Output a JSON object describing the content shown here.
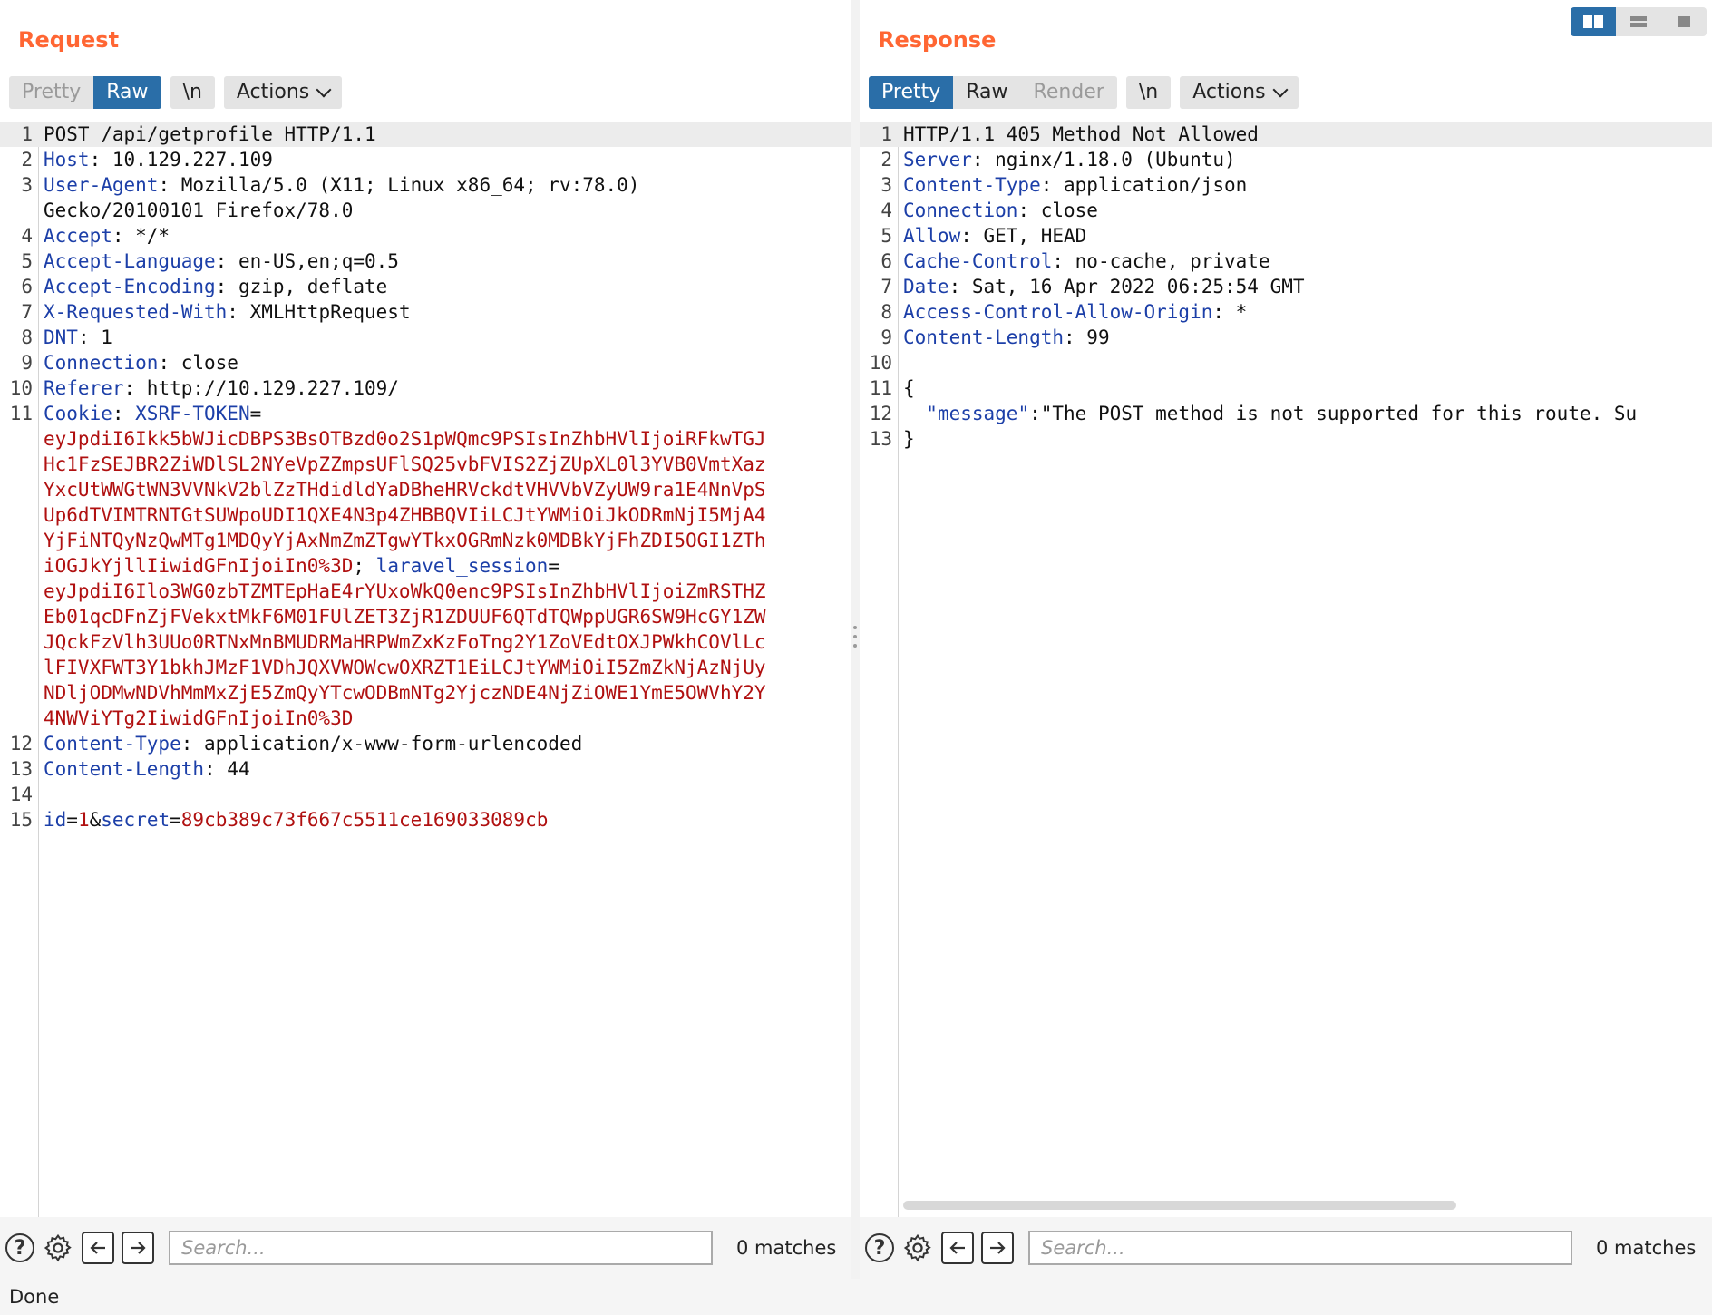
{
  "request": {
    "title": "Request",
    "tabs": [
      "Pretty",
      "Raw"
    ],
    "newline_label": "\\n",
    "actions_label": "Actions",
    "lines": [
      {
        "n": "1",
        "parts": [
          {
            "t": "POST /api/getprofile HTTP/1.1",
            "c": "v"
          }
        ]
      },
      {
        "n": "2",
        "parts": [
          {
            "t": "Host",
            "c": "k"
          },
          {
            "t": ": 10.129.227.109",
            "c": "v"
          }
        ]
      },
      {
        "n": "3",
        "parts": [
          {
            "t": "User-Agent",
            "c": "k"
          },
          {
            "t": ": Mozilla/5.0 (X11; Linux x86_64; rv:78.0)",
            "c": "v"
          }
        ]
      },
      {
        "n": "",
        "parts": [
          {
            "t": "Gecko/20100101 Firefox/78.0",
            "c": "v"
          }
        ]
      },
      {
        "n": "4",
        "parts": [
          {
            "t": "Accept",
            "c": "k"
          },
          {
            "t": ": */*",
            "c": "v"
          }
        ]
      },
      {
        "n": "5",
        "parts": [
          {
            "t": "Accept-Language",
            "c": "k"
          },
          {
            "t": ": en-US,en;q=0.5",
            "c": "v"
          }
        ]
      },
      {
        "n": "6",
        "parts": [
          {
            "t": "Accept-Encoding",
            "c": "k"
          },
          {
            "t": ": gzip, deflate",
            "c": "v"
          }
        ]
      },
      {
        "n": "7",
        "parts": [
          {
            "t": "X-Requested-With",
            "c": "k"
          },
          {
            "t": ": XMLHttpRequest",
            "c": "v"
          }
        ]
      },
      {
        "n": "8",
        "parts": [
          {
            "t": "DNT",
            "c": "k"
          },
          {
            "t": ": 1",
            "c": "v"
          }
        ]
      },
      {
        "n": "9",
        "parts": [
          {
            "t": "Connection",
            "c": "k"
          },
          {
            "t": ": close",
            "c": "v"
          }
        ]
      },
      {
        "n": "10",
        "parts": [
          {
            "t": "Referer",
            "c": "k"
          },
          {
            "t": ": http://10.129.227.109/",
            "c": "v"
          }
        ]
      },
      {
        "n": "11",
        "parts": [
          {
            "t": "Cookie",
            "c": "k"
          },
          {
            "t": ": ",
            "c": "v"
          },
          {
            "t": "XSRF-TOKEN",
            "c": "k"
          },
          {
            "t": "=",
            "c": "v"
          }
        ]
      },
      {
        "n": "",
        "parts": [
          {
            "t": "eyJpdiI6Ikk5bWJicDBPS3BsOTBzd0o2S1pWQmc9PSIsInZhbHVlIjoiRFkwTGJ",
            "c": "r"
          }
        ]
      },
      {
        "n": "",
        "parts": [
          {
            "t": "Hc1FzSEJBR2ZiWDlSL2NYeVpZZmpsUFlSQ25vbFVIS2ZjZUpXL0l3YVB0VmtXaz",
            "c": "r"
          }
        ]
      },
      {
        "n": "",
        "parts": [
          {
            "t": "YxcUtWWGtWN3VVNkV2blZzTHdidldYaDBheHRVckdtVHVVbVZyUW9ra1E4NnVpS",
            "c": "r"
          }
        ]
      },
      {
        "n": "",
        "parts": [
          {
            "t": "Up6dTVIMTRNTGtSUWpoUDI1QXE4N3p4ZHBBQVIiLCJtYWMiOiJkODRmNjI5MjA4",
            "c": "r"
          }
        ]
      },
      {
        "n": "",
        "parts": [
          {
            "t": "YjFiNTQyNzQwMTg1MDQyYjAxNmZmZTgwYTkxOGRmNzk0MDBkYjFhZDI5OGI1ZTh",
            "c": "r"
          }
        ]
      },
      {
        "n": "",
        "parts": [
          {
            "t": "iOGJkYjllIiwidGFnIjoiIn0%3D",
            "c": "r"
          },
          {
            "t": "; ",
            "c": "v"
          },
          {
            "t": "laravel_session",
            "c": "k"
          },
          {
            "t": "=",
            "c": "v"
          }
        ]
      },
      {
        "n": "",
        "parts": [
          {
            "t": "eyJpdiI6Ilo3WG0zbTZMTEpHaE4rYUxoWkQ0enc9PSIsInZhbHVlIjoiZmRSTHZ",
            "c": "r"
          }
        ]
      },
      {
        "n": "",
        "parts": [
          {
            "t": "Eb01qcDFnZjFVekxtMkF6M01FUlZET3ZjR1ZDUUF6QTdTQWppUGR6SW9HcGY1ZW",
            "c": "r"
          }
        ]
      },
      {
        "n": "",
        "parts": [
          {
            "t": "JQckFzVlh3UUo0RTNxMnBMUDRMaHRPWmZxKzFoTng2Y1ZoVEdtOXJPWkhCOVlLc",
            "c": "r"
          }
        ]
      },
      {
        "n": "",
        "parts": [
          {
            "t": "lFIVXFWT3Y1bkhJMzF1VDhJQXVWOWcwOXRZT1EiLCJtYWMiOiI5ZmZkNjAzNjUy",
            "c": "r"
          }
        ]
      },
      {
        "n": "",
        "parts": [
          {
            "t": "NDljODMwNDVhMmMxZjE5ZmQyYTcwODBmNTg2YjczNDE4NjZiOWE1YmE5OWVhY2Y",
            "c": "r"
          }
        ]
      },
      {
        "n": "",
        "parts": [
          {
            "t": "4NWViYTg2IiwidGFnIjoiIn0%3D",
            "c": "r"
          }
        ]
      },
      {
        "n": "12",
        "parts": [
          {
            "t": "Content-Type",
            "c": "k"
          },
          {
            "t": ": application/x-www-form-urlencoded",
            "c": "v"
          }
        ]
      },
      {
        "n": "13",
        "parts": [
          {
            "t": "Content-Length",
            "c": "k"
          },
          {
            "t": ": 44",
            "c": "v"
          }
        ]
      },
      {
        "n": "14",
        "parts": []
      },
      {
        "n": "15",
        "parts": [
          {
            "t": "id",
            "c": "k"
          },
          {
            "t": "=",
            "c": "v"
          },
          {
            "t": "1",
            "c": "r"
          },
          {
            "t": "&",
            "c": "v"
          },
          {
            "t": "secret",
            "c": "k"
          },
          {
            "t": "=",
            "c": "v"
          },
          {
            "t": "89cb389c73f667c5511ce169033089cb",
            "c": "r"
          }
        ]
      }
    ],
    "search": {
      "placeholder": "Search...",
      "matches": "0 matches"
    }
  },
  "response": {
    "title": "Response",
    "tabs": [
      "Pretty",
      "Raw",
      "Render"
    ],
    "newline_label": "\\n",
    "actions_label": "Actions",
    "lines": [
      {
        "n": "1",
        "parts": [
          {
            "t": "HTTP/1.1 405 Method Not Allowed",
            "c": "v"
          }
        ]
      },
      {
        "n": "2",
        "parts": [
          {
            "t": "Server",
            "c": "k"
          },
          {
            "t": ": nginx/1.18.0 (Ubuntu)",
            "c": "v"
          }
        ]
      },
      {
        "n": "3",
        "parts": [
          {
            "t": "Content-Type",
            "c": "k"
          },
          {
            "t": ": application/json",
            "c": "v"
          }
        ]
      },
      {
        "n": "4",
        "parts": [
          {
            "t": "Connection",
            "c": "k"
          },
          {
            "t": ": close",
            "c": "v"
          }
        ]
      },
      {
        "n": "5",
        "parts": [
          {
            "t": "Allow",
            "c": "k"
          },
          {
            "t": ": GET, HEAD",
            "c": "v"
          }
        ]
      },
      {
        "n": "6",
        "parts": [
          {
            "t": "Cache-Control",
            "c": "k"
          },
          {
            "t": ": no-cache, private",
            "c": "v"
          }
        ]
      },
      {
        "n": "7",
        "parts": [
          {
            "t": "Date",
            "c": "k"
          },
          {
            "t": ": Sat, 16 Apr 2022 06:25:54 GMT",
            "c": "v"
          }
        ]
      },
      {
        "n": "8",
        "parts": [
          {
            "t": "Access-Control-Allow-Origin",
            "c": "k"
          },
          {
            "t": ": *",
            "c": "v"
          }
        ]
      },
      {
        "n": "9",
        "parts": [
          {
            "t": "Content-Length",
            "c": "k"
          },
          {
            "t": ": 99",
            "c": "v"
          }
        ]
      },
      {
        "n": "10",
        "parts": []
      },
      {
        "n": "11",
        "parts": [
          {
            "t": "{",
            "c": "v"
          }
        ]
      },
      {
        "n": "12",
        "parts": [
          {
            "t": "  ",
            "c": "v"
          },
          {
            "t": "\"message\"",
            "c": "k"
          },
          {
            "t": ":\"The POST method is not supported for this route. Su",
            "c": "v"
          }
        ]
      },
      {
        "n": "13",
        "parts": [
          {
            "t": "}",
            "c": "v"
          }
        ]
      }
    ],
    "search": {
      "placeholder": "Search...",
      "matches": "0 matches"
    }
  },
  "status": "Done",
  "colors": {
    "accent": "#ff6633",
    "active_tab": "#2a6ea8",
    "key": "#1c3fa8",
    "value_red": "#b01010"
  }
}
